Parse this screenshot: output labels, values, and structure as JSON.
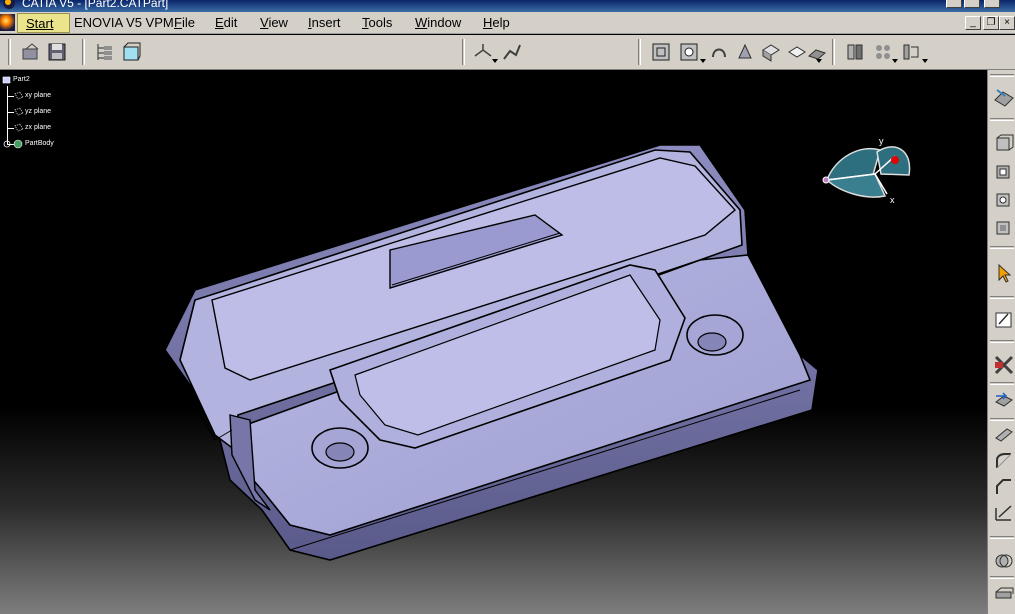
{
  "window": {
    "title": "CATIA V5 - [Part2.CATPart]"
  },
  "menubar": {
    "start": "Start",
    "items": [
      "ENOVIA V5 VPM",
      "File",
      "Edit",
      "View",
      "Insert",
      "Tools",
      "Window",
      "Help"
    ]
  },
  "spec_tree": {
    "root": "Part2",
    "children": [
      "xy plane",
      "yz plane",
      "zx plane",
      "PartBody"
    ]
  },
  "compass": {
    "y_label": "y",
    "x_label": "x"
  },
  "colors": {
    "accent_title": "#0a246a",
    "part_fill": "#a9a9d6",
    "start_button": "#ece48a",
    "toolbar_bg": "#d4d0c8"
  }
}
